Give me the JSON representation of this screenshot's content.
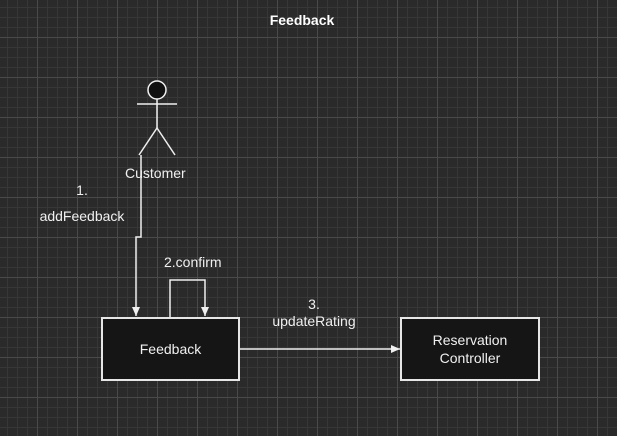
{
  "diagram": {
    "title": "Feedback",
    "actor": {
      "name": "Customer"
    },
    "objects": [
      {
        "id": "feedback",
        "label": "Feedback"
      },
      {
        "id": "reservation_controller",
        "label": "Reservation Controller"
      }
    ],
    "messages": [
      {
        "number": "1.",
        "name": "addFeedback",
        "from": "Customer",
        "to": "Feedback"
      },
      {
        "label": "2.confirm",
        "from": "Feedback",
        "to": "Feedback"
      },
      {
        "number": "3.",
        "name": "updateRating",
        "from": "Feedback",
        "to": "Reservation Controller"
      }
    ]
  }
}
